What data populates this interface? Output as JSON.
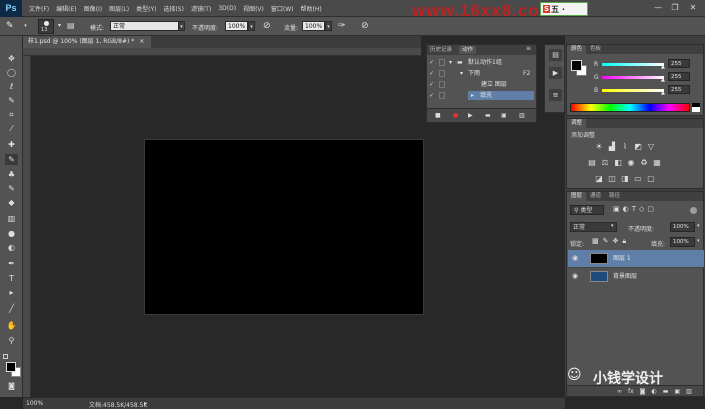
{
  "app": {
    "logo": "Ps"
  },
  "menubar": {
    "items": [
      "文件(F)",
      "编辑(E)",
      "图像(I)",
      "图层(L)",
      "类型(Y)",
      "选择(S)",
      "滤镜(T)",
      "3D(D)",
      "视图(V)",
      "窗口(W)",
      "帮助(H)"
    ]
  },
  "watermark": {
    "site": "www.16xx8.com",
    "badge_s": "S",
    "badge_text": "五 ·"
  },
  "window_controls": {
    "minimize": "—",
    "restore": "❐",
    "close": "✕"
  },
  "options": {
    "brush_size": "13",
    "mode_label": "模式:",
    "mode_value": "正常",
    "opacity_label": "不透明度:",
    "opacity_value": "100%",
    "flow_label": "流量:",
    "flow_value": "100%"
  },
  "document": {
    "tab_title": "样1.psd @ 100% (图层 1, RGB/8#) *",
    "tab_close": "×",
    "zoom": "100%",
    "doc_size": "文档:458.5K/458.5K"
  },
  "actions_panel": {
    "tabs": [
      "历史记录",
      "动作"
    ],
    "rows": [
      {
        "check": "✓",
        "label": "默认动作1组",
        "shortcut": ""
      },
      {
        "check": "✓",
        "label": "下雨",
        "shortcut": "F2"
      },
      {
        "check": "✓",
        "label": "建立 图层",
        "shortcut": ""
      },
      {
        "check": "✓",
        "label": "填充",
        "shortcut": ""
      }
    ]
  },
  "color_panel": {
    "tabs": [
      "颜色",
      "色板"
    ],
    "channels": [
      {
        "label": "R",
        "value": "255",
        "color": "#ff3030"
      },
      {
        "label": "G",
        "value": "255",
        "color": "#30ff30"
      },
      {
        "label": "B",
        "value": "255",
        "color": "#3060ff"
      }
    ]
  },
  "adjustments_panel": {
    "title": "调整",
    "subtitle": "添加调整"
  },
  "layers_panel": {
    "tabs": [
      "图层",
      "通道",
      "路径"
    ],
    "kind_filter": "类型",
    "blend_mode": "正常",
    "opacity_label": "不透明度:",
    "opacity_value": "100%",
    "lock_label": "锁定:",
    "fill_label": "填充:",
    "fill_value": "100%",
    "layers": [
      {
        "name": "图层 1",
        "selected": true,
        "thumb_color": "#000000"
      },
      {
        "name": "背景图层",
        "selected": false,
        "thumb_color": "#1e4a7a"
      }
    ]
  },
  "wechat_watermark": {
    "text": "小钱学设计"
  },
  "colors": {
    "accent_selected": "#5f7fa8",
    "panel_bg": "#535353",
    "app_bg": "#282828"
  }
}
